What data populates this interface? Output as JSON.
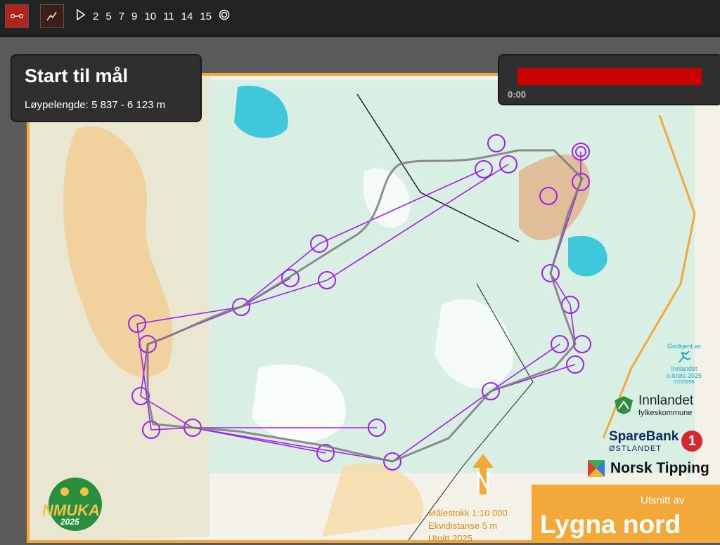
{
  "toolbar": {
    "legs": [
      "2",
      "5",
      "7",
      "9",
      "10",
      "11",
      "14",
      "15"
    ]
  },
  "info": {
    "title": "Start til mål",
    "subtitle": "Løypelengde: 5 837 - 6 123 m"
  },
  "playback": {
    "time": "0:00"
  },
  "sponsors": {
    "innlandet_name": "Innlandet",
    "innlandet_sub": "fylkeskommune",
    "sparebank_a": "SpareBank",
    "sparebank_b": "ØSTLANDET",
    "sparebank_num": "1",
    "norsk": "Norsk Tipping",
    "approved_line1": "Godkjent av",
    "approved_line2": "Innlandet",
    "approved_line3": "o-krets 2025",
    "approved_line4": "07/2509B"
  },
  "map_info": {
    "scale": "Målestokk 1:10 000",
    "contour": "Ekvidistanse 5 m",
    "issued": "Utgitt 2025",
    "excerpt": "Utsnitt av",
    "area": "Lygna nord",
    "event_logo": "NMUKA",
    "event_year": "2025"
  },
  "colors": {
    "course": "#a020f0",
    "route": "#7a7a7a",
    "accent": "#cc0000",
    "orange": "#f2a93a"
  }
}
